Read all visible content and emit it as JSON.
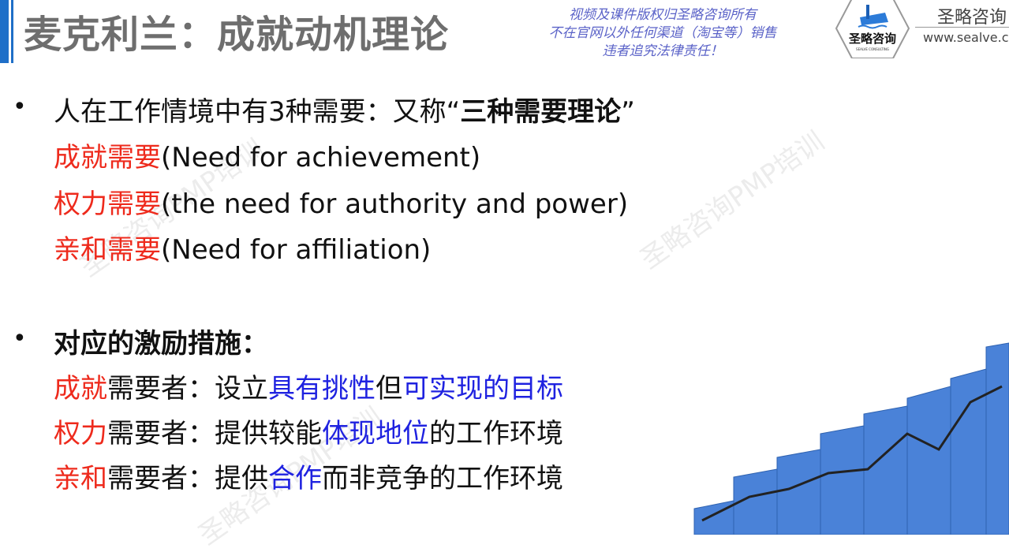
{
  "header": {
    "title": "麦克利兰：成就动机理论"
  },
  "copyright_notice": [
    "视频及课件版权归圣略咨询所有",
    "不在官网以外任何渠道（淘宝等）销售",
    "违者追究法律责任！"
  ],
  "brand": {
    "logo_text": "圣略咨询",
    "logo_subtext": "SEALVE CONSULTING",
    "name": "圣略咨询",
    "url": "www.sealve.c"
  },
  "watermark": "圣略咨询PMP培训",
  "section1": {
    "bullet": "•",
    "intro": "人在工作情境中有3种需要：又称",
    "intro_quote_open": "“",
    "intro_bold": "三种需要理论",
    "intro_quote_close": "”",
    "needs": [
      {
        "cn": "成就需要",
        "en": "(Need for achievement)"
      },
      {
        "cn": "权力需要",
        "en": "(the need for authority and power)"
      },
      {
        "cn": "亲和需要",
        "en": "(Need for affiliation)"
      }
    ]
  },
  "section2": {
    "bullet": "•",
    "heading": "对应的激励措施：",
    "rows": [
      {
        "a": "成就",
        "b": "需要者：设立",
        "c": "具有挑性",
        "d": "但",
        "e": "可实现的目标",
        "f": ""
      },
      {
        "a": "权力",
        "b": "需要者：提供较能",
        "c": "体现地位",
        "d": "的工作环境",
        "e": "",
        "f": ""
      },
      {
        "a": "亲和",
        "b": "需要者：提供",
        "c": "合作",
        "d": "而非竞争的工作环境",
        "e": "",
        "f": ""
      }
    ]
  },
  "colors": {
    "accent": "#1f6fc8",
    "red": "#ee2a1c",
    "blue": "#1f22e0",
    "title": "#6e6e6e"
  }
}
